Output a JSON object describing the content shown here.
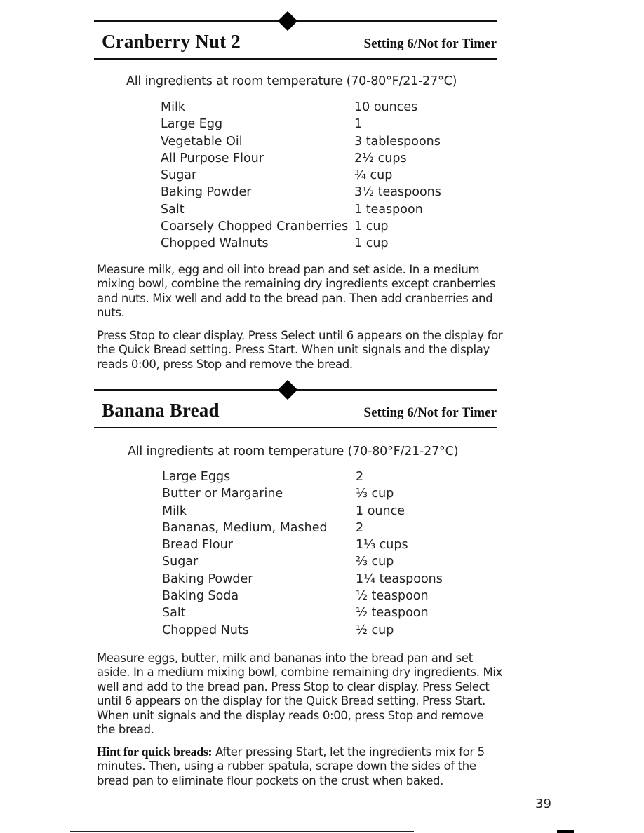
{
  "recipes": [
    {
      "title": "Cranberry Nut 2",
      "setting": "Setting 6/Not for Timer",
      "temperature_note": "All ingredients at room temperature (70-80°F/21-27°C)",
      "ingredients": [
        {
          "name": "Milk",
          "amount": "10 ounces"
        },
        {
          "name": "Large Egg",
          "amount": "1"
        },
        {
          "name": "Vegetable Oil",
          "amount": "3 tablespoons"
        },
        {
          "name": "All Purpose Flour",
          "amount": "2½ cups"
        },
        {
          "name": "Sugar",
          "amount": "¾ cup"
        },
        {
          "name": "Baking Powder",
          "amount": "3½ teaspoons"
        },
        {
          "name": "Salt",
          "amount": "1 teaspoon"
        },
        {
          "name": "Coarsely Chopped Cranberries",
          "amount": "1 cup"
        },
        {
          "name": "Chopped Walnuts",
          "amount": "1 cup"
        }
      ],
      "instructions": [
        "Measure milk, egg and oil into bread pan and set aside. In a medium mixing bowl, combine the remaining dry ingredients except cranberries and nuts. Mix well and add to the bread pan. Then add cranberries and nuts.",
        "Press Stop to clear display. Press Select until 6 appears on the display for the Quick Bread setting. Press Start. When unit signals and the display reads 0:00, press Stop and remove the bread."
      ]
    },
    {
      "title": "Banana Bread",
      "setting": "Setting 6/Not for Timer",
      "temperature_note": "All ingredients at room temperature (70-80°F/21-27°C)",
      "ingredients": [
        {
          "name": "Large Eggs",
          "amount": "2"
        },
        {
          "name": "Butter or Margarine",
          "amount": "⅓ cup"
        },
        {
          "name": "Milk",
          "amount": "1 ounce"
        },
        {
          "name": "Bananas, Medium, Mashed",
          "amount": "2"
        },
        {
          "name": "Bread Flour",
          "amount": "1⅓ cups"
        },
        {
          "name": "Sugar",
          "amount": "⅔ cup"
        },
        {
          "name": "Baking Powder",
          "amount": "1¼ teaspoons"
        },
        {
          "name": "Baking Soda",
          "amount": "½ teaspoon"
        },
        {
          "name": "Salt",
          "amount": "½ teaspoon"
        },
        {
          "name": "Chopped Nuts",
          "amount": "½ cup"
        }
      ],
      "instructions": [
        "Measure eggs, butter, milk and bananas into the bread pan and set aside. In a medium mixing bowl, combine remaining dry ingredients. Mix well and add to the bread pan. Press Stop to clear display. Press Select until 6 appears on the display for the Quick Bread setting. Press Start. When unit signals and the display reads 0:00, press Stop and remove the bread."
      ]
    }
  ],
  "hint": {
    "label": "Hint for quick breads:",
    "text": " After pressing Start, let the ingredients mix for 5 minutes. Then, using a rubber spatula, scrape down the sides of the bread pan to eliminate flour pockets on the crust when baked."
  },
  "page_number": "39"
}
